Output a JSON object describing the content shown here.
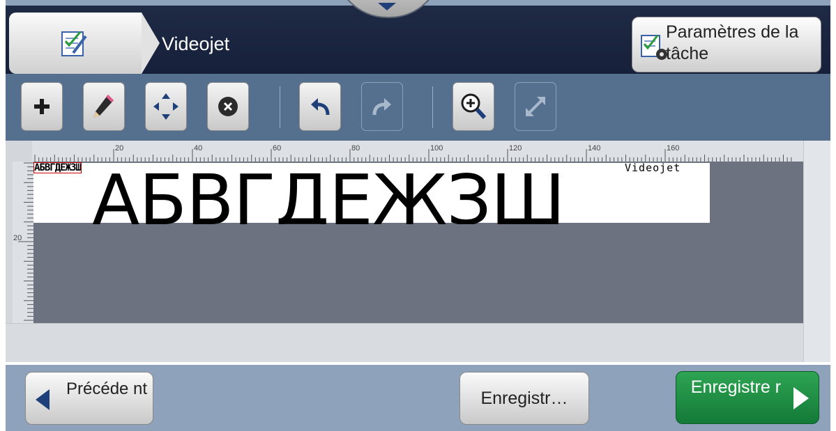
{
  "header": {
    "title": "Videojet",
    "job_params_label": "Paramètres de la tâche"
  },
  "toolbar": {
    "buttons": [
      "plus-icon",
      "pencil-icon",
      "move-icon",
      "delete-icon",
      "undo-icon",
      "redo-icon",
      "zoom-in-icon",
      "fit-icon"
    ],
    "disabled": [
      "redo-icon",
      "fit-icon"
    ]
  },
  "canvas": {
    "h_ruler_labels": [
      "20",
      "40",
      "60",
      "80",
      "100",
      "120",
      "140",
      "160"
    ],
    "v_ruler_labels": [
      "20"
    ],
    "fields": {
      "small_text": "АБВГДЕЖЗШ",
      "large_text": "АБВГДЕЖЗШ",
      "videojet_text": "Videojet"
    }
  },
  "footer": {
    "previous_label": "Précéde nt",
    "save_label": "Enregistr…",
    "save_next_label": "Enregistre r"
  },
  "colors": {
    "header_bg": "#1f2a44",
    "toolbar_bg": "#55708f",
    "workspace_bg": "#6c7280",
    "footer_bg": "#8fa2bc",
    "accent_green": "#1f8f44",
    "accent_blue": "#1f3f79",
    "selection_outline": "#cc0000"
  }
}
